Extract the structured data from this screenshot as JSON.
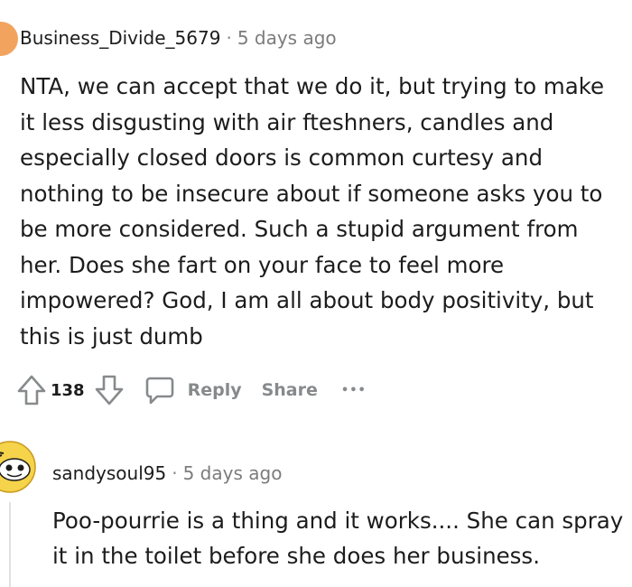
{
  "comment1": {
    "username": "Business_Divide_5679",
    "separator": "·",
    "time": "5 days ago",
    "text": "NTA, we can accept that we do it, but trying to make it less disgusting with air fteshners, candles and especially closed doors is common curtesy and nothing to be insecure about if someone asks you to be more considered. Such a stupid argument from her. Does she fart on your face to feel more impowered? God, I am all about body positivity, but this is just dumb",
    "votes": "138",
    "reply_label": "Reply",
    "share_label": "Share",
    "more_label": "•••"
  },
  "comment2": {
    "username": "sandysoul95",
    "separator": "·",
    "time": "5 days ago",
    "text": "Poo-pourrie is a thing and it works.... She can spray it in the toilet before she does her business."
  },
  "icons": [
    "upvote-icon",
    "downvote-icon",
    "comment-icon"
  ],
  "colors": {
    "text": "#1c1c1c",
    "muted": "#878a8c",
    "avatar_orange": "#f2a35e",
    "snoo_yellow": "#f5d34a"
  }
}
